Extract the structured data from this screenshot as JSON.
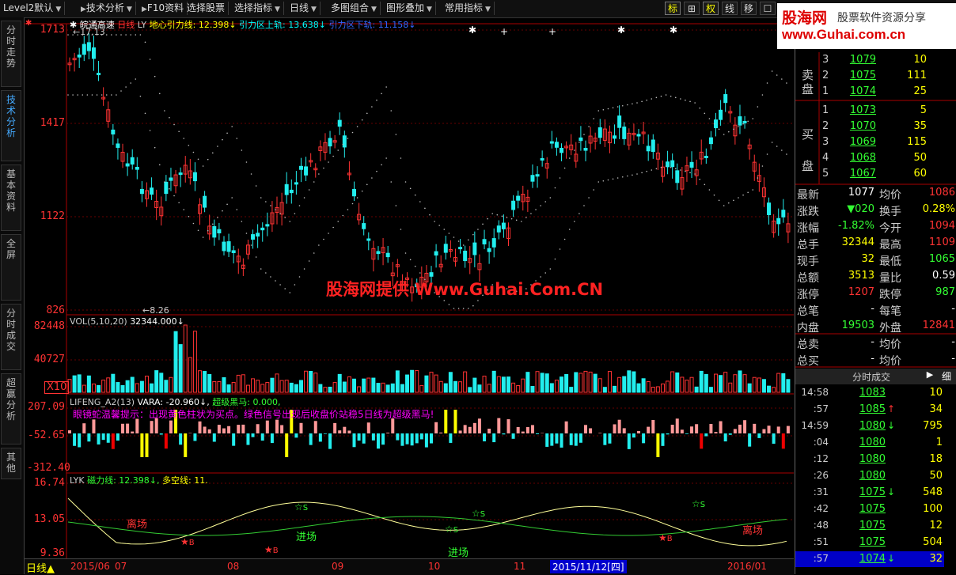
{
  "menu": {
    "items": [
      "Level2默认",
      "技术分析",
      "F10资料",
      "选择股票",
      "选择指标",
      "日线",
      "多图组合",
      "图形叠加",
      "常用指标"
    ],
    "tool_buttons": [
      "标",
      "⊞",
      "权",
      "线",
      "移",
      "☐"
    ]
  },
  "watermark": {
    "title": "股海网",
    "slogan": "股票软件资源分享",
    "url": "www.Guhai.com.cn"
  },
  "left_tabs": [
    "分时走势",
    "技术分析",
    "基本资料",
    "全屏",
    "分时成交",
    "超赢分析",
    "其他"
  ],
  "main_chart": {
    "stock_name": "皖通高速",
    "period": "日线",
    "formula": "LY",
    "line1_label": "地心引力线:",
    "line1_value": "12.398↓",
    "line2_label": "引力区上轨:",
    "line2_value": "13.638↓",
    "line3_label": "引力区下轨:",
    "line3_value": "11.158↓",
    "y_labels": [
      "1713",
      "1417",
      "1122",
      "826"
    ],
    "high_marker": "17.13",
    "low_marker": "8.26",
    "promo": "股海网提供 Www.Guhai.Com.CN"
  },
  "vol_panel": {
    "label": "VOL(5,10,20)",
    "value": "32344.000↓",
    "y_labels": [
      "82448",
      "40727"
    ],
    "unit": "X10"
  },
  "lifeng_panel": {
    "label": "LIFENG_A2(13)",
    "vara": "VARA: -20.960↓,",
    "chaoji": "超级黑马: 0.000,",
    "hint": "眼镜蛇温馨提示：出现黄色柱状为买点。绿色信号出现后收盘价站稳5日线为超级黑马!",
    "y_labels": [
      "207.09",
      "-52.65",
      "-312.40"
    ]
  },
  "lyk_panel": {
    "label": "LYK",
    "line_a": "磁力线: 12.398↓,",
    "line_b": "多空线: 11.",
    "y_labels": [
      "16.74",
      "13.05",
      "9.36"
    ],
    "signals": [
      "离场",
      "离场",
      "进场",
      "进场",
      "离场"
    ]
  },
  "bottom_bar": {
    "period": "日线",
    "dates": [
      "2015/06",
      "07",
      "08",
      "09",
      "10",
      "11",
      "2016/01"
    ],
    "cursor_date": "2015/11/12[四]"
  },
  "order_book": {
    "sell_label": "卖盘",
    "buy_label": "买盘",
    "sell": [
      {
        "lvl": "3",
        "price": "1079",
        "vol": "10"
      },
      {
        "lvl": "2",
        "price": "1075",
        "vol": "111"
      },
      {
        "lvl": "1",
        "price": "1074",
        "vol": "25"
      }
    ],
    "buy": [
      {
        "lvl": "1",
        "price": "1073",
        "vol": "5"
      },
      {
        "lvl": "2",
        "price": "1070",
        "vol": "35"
      },
      {
        "lvl": "3",
        "price": "1069",
        "vol": "115"
      },
      {
        "lvl": "4",
        "price": "1068",
        "vol": "50"
      },
      {
        "lvl": "5",
        "price": "1067",
        "vol": "60"
      }
    ]
  },
  "quote": [
    {
      "l": "最新",
      "v": "1077",
      "vc": "#fff",
      "l2": "均价",
      "v2": "1086",
      "vc2": "#f33"
    },
    {
      "l": "涨跌",
      "v": "▼020",
      "vc": "#3f3",
      "l2": "换手",
      "v2": "0.28%",
      "vc2": "#ff0"
    },
    {
      "l": "涨幅",
      "v": "-1.82%",
      "vc": "#3f3",
      "l2": "今开",
      "v2": "1094",
      "vc2": "#f33"
    },
    {
      "l": "总手",
      "v": "32344",
      "vc": "#ff0",
      "l2": "最高",
      "v2": "1109",
      "vc2": "#f33"
    },
    {
      "l": "现手",
      "v": "32",
      "vc": "#ff0",
      "l2": "最低",
      "v2": "1065",
      "vc2": "#3f3"
    },
    {
      "l": "总额",
      "v": "3513",
      "vc": "#ff0",
      "l2": "量比",
      "v2": "0.59",
      "vc2": "#fff"
    },
    {
      "l": "涨停",
      "v": "1207",
      "vc": "#f33",
      "l2": "跌停",
      "v2": "987",
      "vc2": "#3f3"
    },
    {
      "l": "总笔",
      "v": "-",
      "vc": "#fff",
      "l2": "每笔",
      "v2": "-",
      "vc2": "#fff"
    },
    {
      "l": "内盘",
      "v": "19503",
      "vc": "#3f3",
      "l2": "外盘",
      "v2": "12841",
      "vc2": "#f33"
    },
    {
      "l": "总卖",
      "v": "-",
      "vc": "#fff",
      "l2": "均价",
      "v2": "-",
      "vc2": "#fff"
    },
    {
      "l": "总买",
      "v": "-",
      "vc": "#fff",
      "l2": "均价",
      "v2": "-",
      "vc2": "#fff"
    }
  ],
  "trades_header": {
    "title": "分时成交",
    "detail": "细"
  },
  "trades": [
    {
      "t": "14:58",
      "p": "1083",
      "a": "",
      "v": "10"
    },
    {
      "t": ":57",
      "p": "1085",
      "a": "↑",
      "v": "34"
    },
    {
      "t": "14:59",
      "p": "1080",
      "a": "↓",
      "v": "795"
    },
    {
      "t": ":04",
      "p": "1080",
      "a": "",
      "v": "1"
    },
    {
      "t": ":12",
      "p": "1080",
      "a": "",
      "v": "18"
    },
    {
      "t": ":26",
      "p": "1080",
      "a": "",
      "v": "50"
    },
    {
      "t": ":31",
      "p": "1075",
      "a": "↓",
      "v": "548"
    },
    {
      "t": ":42",
      "p": "1075",
      "a": "",
      "v": "100"
    },
    {
      "t": ":48",
      "p": "1075",
      "a": "",
      "v": "12"
    },
    {
      "t": ":51",
      "p": "1075",
      "a": "",
      "v": "504"
    },
    {
      "t": ":57",
      "p": "1074",
      "a": "↓",
      "v": "32"
    }
  ]
}
